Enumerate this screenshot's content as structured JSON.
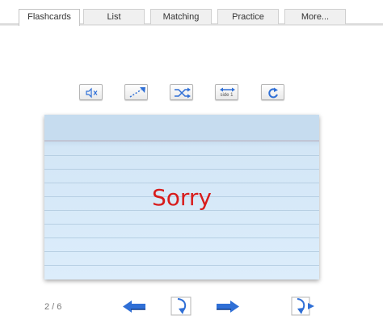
{
  "tabs": [
    {
      "label": "Flashcards",
      "active": true
    },
    {
      "label": "List",
      "active": false
    },
    {
      "label": "Matching",
      "active": false
    },
    {
      "label": "Practice",
      "active": false
    },
    {
      "label": "More...",
      "active": false
    }
  ],
  "toolbar": {
    "mute_icon": "speaker-muted-icon",
    "autoplay_icon": "autoplay-arrow-icon",
    "shuffle_icon": "shuffle-icon",
    "side_label": "side 1",
    "refresh_icon": "refresh-icon"
  },
  "card": {
    "text": "Sorry",
    "text_color": "#d81c1c"
  },
  "nav": {
    "counter": "2 / 6",
    "accent_color": "#2f6fd6"
  }
}
